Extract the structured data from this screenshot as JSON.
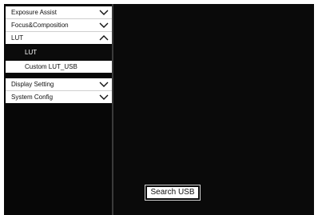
{
  "menu": {
    "exposure_assist": "Exposure Assist",
    "focus_composition": "Focus&Composition",
    "lut": "LUT",
    "lut_sub_lut": "LUT",
    "lut_sub_custom": "Custom LUT_USB",
    "display_setting": "Display Setting",
    "system_config": "System Config"
  },
  "icons": {
    "collapsed": "chevron-down-icon",
    "expanded": "chevron-up-icon"
  },
  "content": {
    "search_button": "Search USB"
  },
  "colors": {
    "background": "#0a0a0a",
    "menu_item_bg": "#ffffff",
    "selected_item_bg": "#0b0b0b"
  }
}
